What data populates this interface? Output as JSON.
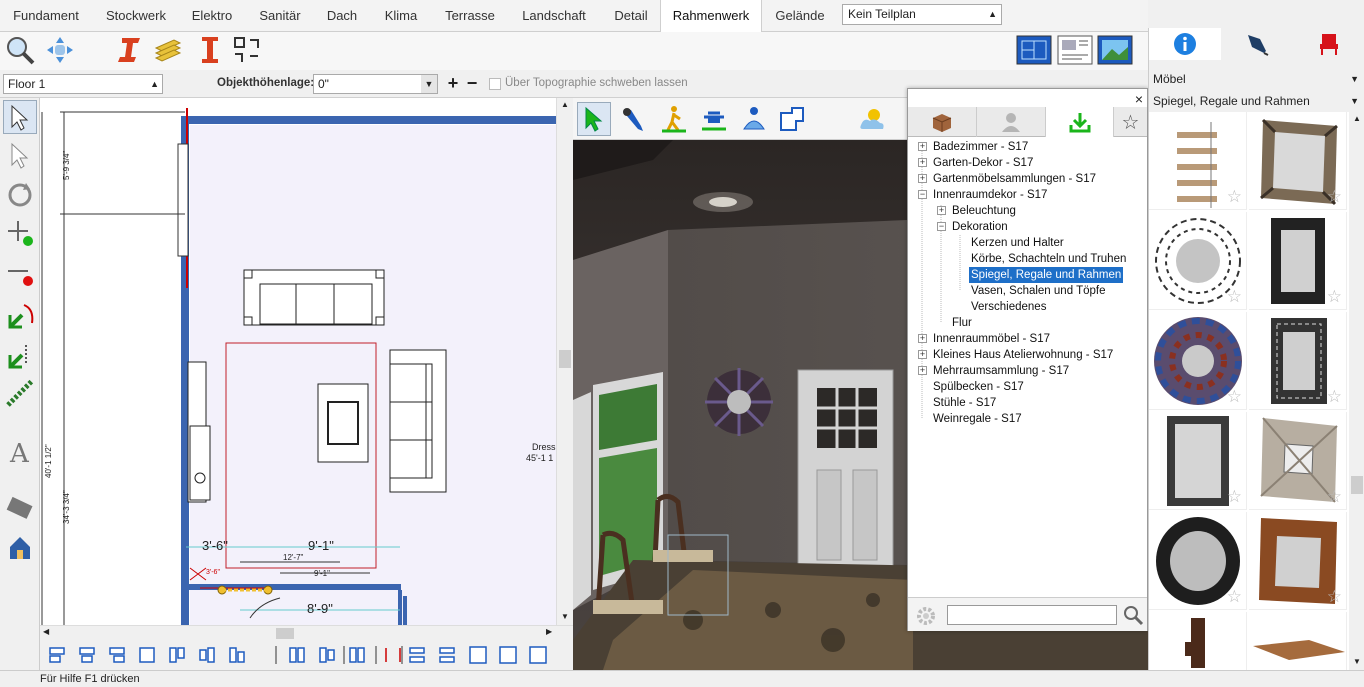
{
  "tabs": [
    "Fundament",
    "Stockwerk",
    "Elektro",
    "Sanitär",
    "Dach",
    "Klima",
    "Terrasse",
    "Landschaft",
    "Detail",
    "Rahmenwerk",
    "Gelände"
  ],
  "active_tab": "Rahmenwerk",
  "teilplan_select": "Kein Teilplan",
  "floor_select": "Floor 1",
  "objekthoehe_label": "Objekthöhenlage:",
  "objekthoehe_value": "0\"",
  "float_checkbox_label": "Über Topographie schweben lassen",
  "plan": {
    "dims": [
      "5'-9 3/4\"",
      "40'-1 1/2\"",
      "34'-3 3/4\"",
      "3'-6\"",
      "9'-1\"",
      "12'-7\"",
      "9'-1\"",
      "8'-9\"",
      "3'-6\""
    ],
    "label_dress": "Dress",
    "label_dress_dim": "45'-1 1"
  },
  "library": {
    "close": "×",
    "tree": [
      {
        "label": "Badezimmer - S17",
        "level": 0,
        "toggle": "+"
      },
      {
        "label": "Garten-Dekor - S17",
        "level": 0,
        "toggle": "+"
      },
      {
        "label": "Gartenmöbelsammlungen - S17",
        "level": 0,
        "toggle": "+"
      },
      {
        "label": "Innenraumdekor - S17",
        "level": 0,
        "toggle": "-"
      },
      {
        "label": "Beleuchtung",
        "level": 1,
        "toggle": "+"
      },
      {
        "label": "Dekoration",
        "level": 1,
        "toggle": "-"
      },
      {
        "label": "Kerzen und Halter",
        "level": 2,
        "toggle": ""
      },
      {
        "label": "Körbe, Schachteln und Truhen",
        "level": 2,
        "toggle": ""
      },
      {
        "label": "Spiegel, Regale und Rahmen",
        "level": 2,
        "toggle": "",
        "selected": true
      },
      {
        "label": "Vasen, Schalen und Töpfe",
        "level": 2,
        "toggle": ""
      },
      {
        "label": "Verschiedenes",
        "level": 2,
        "toggle": ""
      },
      {
        "label": "Flur",
        "level": 1,
        "toggle": ""
      },
      {
        "label": "Innenraummöbel - S17",
        "level": 0,
        "toggle": "+"
      },
      {
        "label": "Kleines Haus Atelierwohnung - S17",
        "level": 0,
        "toggle": "+"
      },
      {
        "label": "Mehrraumsammlung - S17",
        "level": 0,
        "toggle": "+"
      },
      {
        "label": "Spülbecken - S17",
        "level": 0,
        "toggle": ""
      },
      {
        "label": "Stühle - S17",
        "level": 0,
        "toggle": ""
      },
      {
        "label": "Weinregale - S17",
        "level": 0,
        "toggle": ""
      }
    ],
    "search_value": ""
  },
  "right_panel": {
    "category_select": "Möbel",
    "subcategory_select": "Spiegel, Regale und Rahmen",
    "items": [
      "wall-shelf",
      "square-framed-mirror",
      "sunburst-mirror",
      "black-frame-mirror",
      "mosaic-round-mirror",
      "greek-key-mirror",
      "dark-frame-mirror",
      "ornate-silver-mirror",
      "scalloped-black-mirror",
      "rustic-wood-mirror",
      "wall-hook",
      "floating-shelf"
    ],
    "star": "☆"
  },
  "status": "Für Hilfe F1 drücken"
}
